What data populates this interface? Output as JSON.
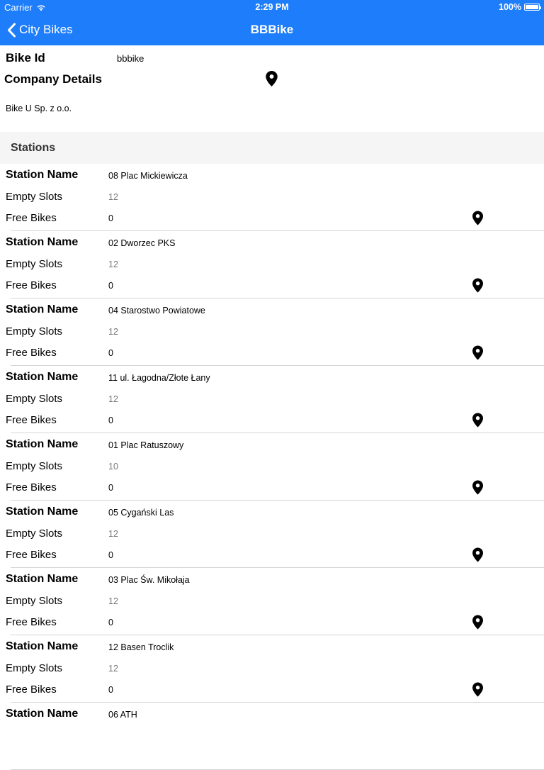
{
  "status_bar": {
    "carrier": "Carrier",
    "time": "2:29 PM",
    "battery": "100%"
  },
  "nav": {
    "back_label": "City Bikes",
    "title": "BBBike"
  },
  "details": {
    "bike_id_label": "Bike Id",
    "bike_id_value": "bbbike",
    "company_label": "Company Details",
    "company_name": "Bike U Sp. z o.o."
  },
  "stations_header": "Stations",
  "labels": {
    "station_name": "Station Name",
    "empty_slots": "Empty Slots",
    "free_bikes": "Free Bikes"
  },
  "stations": [
    {
      "name": "08 Plac Mickiewicza",
      "empty_slots": "12",
      "free_bikes": "0"
    },
    {
      "name": "02 Dworzec PKS",
      "empty_slots": "12",
      "free_bikes": "0"
    },
    {
      "name": "04 Starostwo Powiatowe",
      "empty_slots": "12",
      "free_bikes": "0"
    },
    {
      "name": "11 ul. Łagodna/Złote Łany",
      "empty_slots": "12",
      "free_bikes": "0"
    },
    {
      "name": "01 Plac Ratuszowy",
      "empty_slots": "10",
      "free_bikes": "0"
    },
    {
      "name": "05 Cygański Las",
      "empty_slots": "12",
      "free_bikes": "0"
    },
    {
      "name": "03 Plac Św. Mikołaja",
      "empty_slots": "12",
      "free_bikes": "0"
    },
    {
      "name": "12 Basen Troclik",
      "empty_slots": "12",
      "free_bikes": "0"
    },
    {
      "name": "06 ATH"
    }
  ],
  "icons": {
    "back": "chevron-left-icon",
    "pin": "map-pin-icon",
    "wifi": "wifi-icon",
    "battery": "battery-icon"
  },
  "colors": {
    "nav_background": "#1e7dfa",
    "section_header_background": "#f5f5f5"
  }
}
